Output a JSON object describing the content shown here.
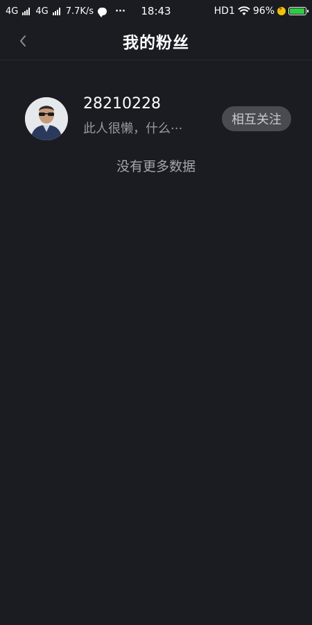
{
  "status_bar": {
    "network1": "4G",
    "network2": "4G",
    "speed": "7.7K/s",
    "more": "···",
    "time": "18:43",
    "hd": "HD1",
    "battery_percent": "96%",
    "battery_level": 0.96
  },
  "header": {
    "title": "我的粉丝"
  },
  "fans": [
    {
      "name": "28210228",
      "bio": "此人很懒，什么···",
      "follow_label": "相互关注"
    }
  ],
  "footer": {
    "no_more_text": "没有更多数据"
  },
  "colors": {
    "background": "#1b1c21",
    "follow_button": "#4a4b50",
    "battery": "#2ecc40"
  }
}
